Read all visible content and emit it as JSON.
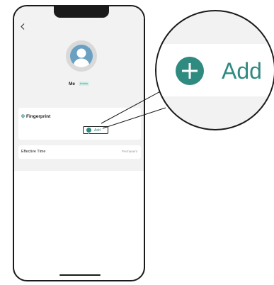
{
  "header": {
    "back_icon": "chevron-left-icon"
  },
  "profile": {
    "name": "Me",
    "role_badge": "Admin",
    "avatar_icon": "user-avatar-icon"
  },
  "fingerprint": {
    "title": "Fingerprint",
    "icon": "fingerprint-icon",
    "add_label": "Add",
    "add_icon": "plus-circle-icon"
  },
  "effective_time": {
    "label": "Effective Time",
    "value": "Permanent"
  },
  "zoom": {
    "add_label": "Add",
    "add_icon": "plus-circle-icon"
  },
  "colors": {
    "accent": "#2f8a80",
    "badge_bg": "#d6efe9",
    "screen_bg": "#f2f2f2",
    "avatar": "#6aa0c2"
  }
}
